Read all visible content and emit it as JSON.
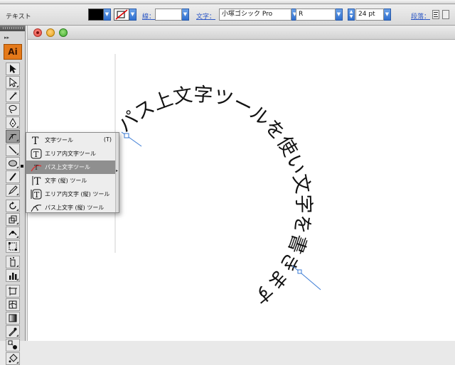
{
  "app": {
    "logo": "Ai"
  },
  "control_bar": {
    "tool_name": "テキスト",
    "stroke_label": "線：",
    "char_label": "文字：",
    "font_family": "小塚ゴシック Pro",
    "font_style": "R",
    "font_size": "24 pt",
    "paragraph_label": "段落："
  },
  "canvas": {
    "path_text": "パス上文字ツールを使い文字を書きます"
  },
  "flyout": {
    "items": [
      {
        "label": "文字ツール",
        "shortcut": "(T)",
        "icon": "type-tool-icon"
      },
      {
        "label": "エリア内文字ツール",
        "shortcut": "",
        "icon": "area-type-tool-icon"
      },
      {
        "label": "パス上文字ツール",
        "shortcut": "",
        "icon": "type-on-path-tool-icon",
        "selected": true
      },
      {
        "label": "文字 (縦) ツール",
        "shortcut": "",
        "icon": "vertical-type-tool-icon"
      },
      {
        "label": "エリア内文字 (縦) ツール",
        "shortcut": "",
        "icon": "vertical-area-type-tool-icon"
      },
      {
        "label": "パス上文字 (縦) ツール",
        "shortcut": "",
        "icon": "vertical-type-on-path-tool-icon"
      }
    ]
  },
  "colors": {
    "accent": "#2f6fcf",
    "logo": "#e4791a",
    "selection_path": "#3a7bd5"
  }
}
